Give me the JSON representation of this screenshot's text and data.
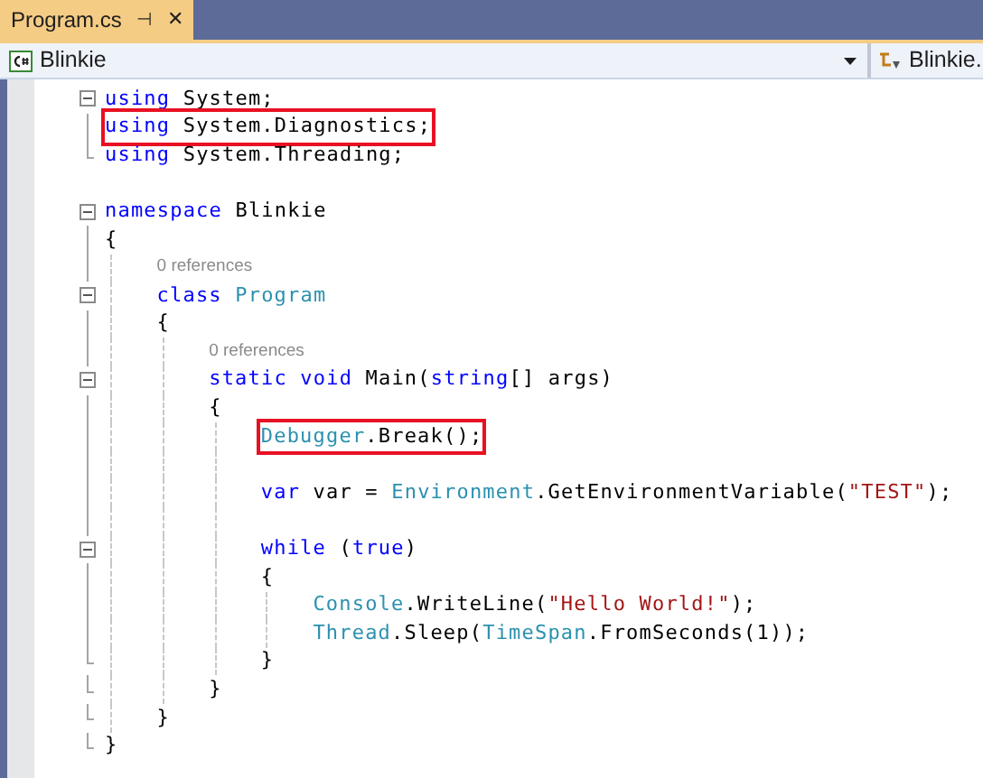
{
  "tab": {
    "title": "Program.cs",
    "pin": "⊣",
    "close": "✕",
    "selected": true
  },
  "nav": {
    "left": "Blinkie",
    "right": "Blinkie."
  },
  "lines": [
    {
      "kind": "code",
      "collapsible": true,
      "tokens": [
        {
          "kind": "keyword",
          "s": "using"
        },
        {
          "kind": "plain",
          "s": " System;"
        }
      ]
    },
    {
      "kind": "code",
      "boxed": true,
      "tokens": [
        {
          "kind": "keyword",
          "s": "using"
        },
        {
          "kind": "plain",
          "s": " System.Diagnostics;"
        }
      ]
    },
    {
      "kind": "code",
      "tokens": [
        {
          "kind": "keyword",
          "s": "using"
        },
        {
          "kind": "plain",
          "s": " System.Threading;"
        }
      ]
    },
    {
      "kind": "blank"
    },
    {
      "kind": "code",
      "collapsible": true,
      "tokens": [
        {
          "kind": "keyword",
          "s": "namespace"
        },
        {
          "kind": "plain",
          "s": " Blinkie"
        }
      ]
    },
    {
      "kind": "code",
      "tokens": [
        {
          "kind": "plain",
          "s": "{"
        }
      ]
    },
    {
      "kind": "codelens",
      "text": "    0 references"
    },
    {
      "kind": "code",
      "collapsible": true,
      "tokens": [
        {
          "kind": "keyword",
          "s": "    class"
        },
        {
          "kind": "type",
          "s": " Program"
        }
      ]
    },
    {
      "kind": "code",
      "tokens": [
        {
          "kind": "plain",
          "s": "    {"
        }
      ]
    },
    {
      "kind": "codelens",
      "text": "        0 references"
    },
    {
      "kind": "code",
      "collapsible": true,
      "tokens": [
        {
          "kind": "keyword",
          "s": "        static void"
        },
        {
          "kind": "plain",
          "s": " Main("
        },
        {
          "kind": "keyword",
          "s": "string"
        },
        {
          "kind": "plain",
          "s": "[] args)"
        }
      ]
    },
    {
      "kind": "code",
      "tokens": [
        {
          "kind": "plain",
          "s": "        {"
        }
      ]
    },
    {
      "kind": "code",
      "boxed": true,
      "tokens": [
        {
          "kind": "type",
          "s": "            Debugger"
        },
        {
          "kind": "plain",
          "s": ".Break();"
        }
      ]
    },
    {
      "kind": "blank"
    },
    {
      "kind": "code",
      "tokens": [
        {
          "kind": "keyword",
          "s": "            var"
        },
        {
          "kind": "plain",
          "s": " var = "
        },
        {
          "kind": "type",
          "s": "Environment"
        },
        {
          "kind": "plain",
          "s": ".GetEnvironmentVariable("
        },
        {
          "kind": "string",
          "s": "\"TEST\""
        },
        {
          "kind": "plain",
          "s": ");"
        }
      ]
    },
    {
      "kind": "blank"
    },
    {
      "kind": "code",
      "collapsible": true,
      "tokens": [
        {
          "kind": "keyword",
          "s": "            while"
        },
        {
          "kind": "plain",
          "s": " ("
        },
        {
          "kind": "keyword",
          "s": "true"
        },
        {
          "kind": "plain",
          "s": ")"
        }
      ]
    },
    {
      "kind": "code",
      "tokens": [
        {
          "kind": "plain",
          "s": "            {"
        }
      ]
    },
    {
      "kind": "code",
      "tokens": [
        {
          "kind": "type",
          "s": "                Console"
        },
        {
          "kind": "plain",
          "s": ".WriteLine("
        },
        {
          "kind": "string",
          "s": "\"Hello World!\""
        },
        {
          "kind": "plain",
          "s": ");"
        }
      ]
    },
    {
      "kind": "code",
      "tokens": [
        {
          "kind": "type",
          "s": "                Thread"
        },
        {
          "kind": "plain",
          "s": ".Sleep("
        },
        {
          "kind": "type",
          "s": "TimeSpan"
        },
        {
          "kind": "plain",
          "s": ".FromSeconds(1));"
        }
      ]
    },
    {
      "kind": "code",
      "tokens": [
        {
          "kind": "plain",
          "s": "            }"
        }
      ]
    },
    {
      "kind": "code",
      "tokens": [
        {
          "kind": "plain",
          "s": "        }"
        }
      ]
    },
    {
      "kind": "code",
      "tokens": [
        {
          "kind": "plain",
          "s": "    }"
        }
      ]
    },
    {
      "kind": "code",
      "tokens": [
        {
          "kind": "plain",
          "s": "}"
        }
      ]
    }
  ]
}
